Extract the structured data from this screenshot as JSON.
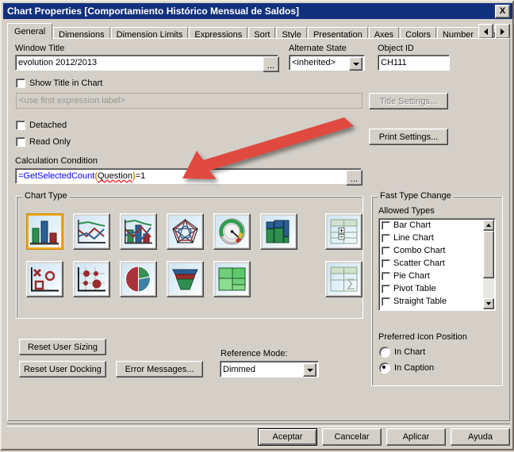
{
  "window": {
    "title": "Chart Properties [Comportamiento Histórico Mensual de Saldos]",
    "close_label": "X",
    "titlebar_color": "#11307e",
    "face_color": "#d4d0c8"
  },
  "tabs": {
    "items": [
      {
        "label": "General",
        "active": true
      },
      {
        "label": "Dimensions",
        "active": false
      },
      {
        "label": "Dimension Limits",
        "active": false
      },
      {
        "label": "Expressions",
        "active": false
      },
      {
        "label": "Sort",
        "active": false
      },
      {
        "label": "Style",
        "active": false
      },
      {
        "label": "Presentation",
        "active": false
      },
      {
        "label": "Axes",
        "active": false
      },
      {
        "label": "Colors",
        "active": false
      },
      {
        "label": "Number",
        "active": false
      },
      {
        "label": "Font",
        "active": false
      }
    ],
    "scroll_left_icon": "triangle-left-icon",
    "scroll_right_icon": "triangle-right-icon"
  },
  "general": {
    "window_title_label": "Window Title",
    "window_title_value": "evolution 2012/2013",
    "window_title_browse_label": "...",
    "alternate_state_label": "Alternate State",
    "alternate_state_value": "<inherited>",
    "object_id_label": "Object ID",
    "object_id_value": "CH111",
    "show_title_in_chart_label": "Show Title in Chart",
    "show_title_in_chart_checked": false,
    "title_expression_placeholder": "<use first expression label>",
    "title_settings_label": "Title Settings...",
    "title_settings_enabled": false,
    "detached_label": "Detached",
    "detached_checked": false,
    "read_only_label": "Read Only",
    "read_only_checked": false,
    "print_settings_label": "Print Settings...",
    "calculation_condition_label": "Calculation Condition",
    "calculation_condition_browse_label": "...",
    "calculation_condition_expression": {
      "full_text": "=GetSelectedCount(Question)=1",
      "parts": [
        {
          "text": "=GetSelectedCount",
          "style": "function",
          "color": "#0000ff"
        },
        {
          "text": "(",
          "style": "paren",
          "color": "#e08c00"
        },
        {
          "text": "Question",
          "style": "field-error",
          "color": "#000000"
        },
        {
          "text": ")",
          "style": "paren",
          "color": "#e08c00"
        },
        {
          "text": "=1",
          "style": "plain",
          "color": "#000000"
        }
      ]
    }
  },
  "chart_type": {
    "group_label": "Chart Type",
    "selected_index": 0,
    "selection_color": "#f3a81b",
    "items": [
      {
        "name": "bar-chart-icon",
        "label": "Bar Chart",
        "selected": true
      },
      {
        "name": "line-chart-icon",
        "label": "Line Chart",
        "selected": false
      },
      {
        "name": "combo-chart-icon",
        "label": "Combo Chart",
        "selected": false
      },
      {
        "name": "radar-chart-icon",
        "label": "Radar Chart",
        "selected": false
      },
      {
        "name": "gauge-chart-icon",
        "label": "Gauge Chart",
        "selected": false
      },
      {
        "name": "mekko-chart-icon",
        "label": "Mekko Chart",
        "selected": false
      },
      {
        "name": "pivot-table-icon",
        "label": "Pivot Table",
        "selected": false
      },
      {
        "name": "scatter-chart-icon",
        "label": "Scatter Chart",
        "selected": false
      },
      {
        "name": "grid-chart-icon",
        "label": "Grid Chart",
        "selected": false
      },
      {
        "name": "pie-chart-icon",
        "label": "Pie Chart",
        "selected": false
      },
      {
        "name": "funnel-chart-icon",
        "label": "Funnel Chart",
        "selected": false
      },
      {
        "name": "block-chart-icon",
        "label": "Block Chart",
        "selected": false
      },
      {
        "name": "straight-table-icon",
        "label": "Straight Table",
        "selected": false
      }
    ]
  },
  "fast_type_change": {
    "group_label": "Fast Type Change",
    "allowed_types_label": "Allowed Types",
    "allowed_types": [
      {
        "label": "Bar Chart",
        "checked": false
      },
      {
        "label": "Line Chart",
        "checked": false
      },
      {
        "label": "Combo Chart",
        "checked": false
      },
      {
        "label": "Scatter Chart",
        "checked": false
      },
      {
        "label": "Pie Chart",
        "checked": false
      },
      {
        "label": "Pivot Table",
        "checked": false
      },
      {
        "label": "Straight Table",
        "checked": false
      }
    ],
    "preferred_icon_position_label": "Preferred Icon Position",
    "position_options": [
      {
        "label": "In Chart",
        "selected": false
      },
      {
        "label": "In Caption",
        "selected": true
      }
    ]
  },
  "bottom_controls": {
    "reset_user_sizing_label": "Reset User Sizing",
    "reset_user_docking_label": "Reset User Docking",
    "error_messages_label": "Error Messages...",
    "reference_mode_label": "Reference Mode:",
    "reference_mode_value": "Dimmed"
  },
  "dialog_buttons": [
    {
      "label": "Aceptar",
      "default": true
    },
    {
      "label": "Cancelar",
      "default": false
    },
    {
      "label": "Aplicar",
      "default": false
    },
    {
      "label": "Ayuda",
      "default": false
    }
  ],
  "annotation": {
    "arrow_color": "#e04a3f",
    "arrow_points_to": "Calculation Condition"
  }
}
